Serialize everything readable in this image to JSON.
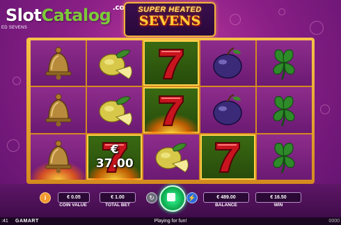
{
  "watermark": {
    "slot": "Slot",
    "catalog": "Catalog",
    "com": ".com"
  },
  "game_small_title": "ED SEVENS",
  "logo": {
    "top": "SUPER HEATED",
    "main": "SEVENS"
  },
  "reels": [
    [
      "bell",
      "bell",
      "fire-bell"
    ],
    [
      "lemon",
      "lemon",
      "win-seven"
    ],
    [
      "seven",
      "fire-seven",
      "lemon"
    ],
    [
      "plum",
      "plum",
      "seven"
    ],
    [
      "clover",
      "clover",
      "clover"
    ]
  ],
  "win_overlay": "€ 37.00",
  "controls": {
    "info_symbol": "i",
    "coin_value": "€ 0.05",
    "coin_value_label": "COIN VALUE",
    "total_bet": "€ 1.00",
    "total_bet_label": "TOTAL BET",
    "autoplay_symbol": "↻",
    "turbo_symbol": "⚡",
    "balance": "€ 489.00",
    "balance_label": "BALANCE",
    "win": "€ 16.50",
    "win_label": "WIN"
  },
  "status_bar": {
    "time": ":41",
    "brand": "GAMART",
    "message": "Playing for fun!",
    "version": "0000"
  },
  "colors": {
    "background": "#8a1f86",
    "reel_frame": "#f2b23a",
    "highlight": "#ffd14a",
    "spin_button": "#12b658"
  }
}
